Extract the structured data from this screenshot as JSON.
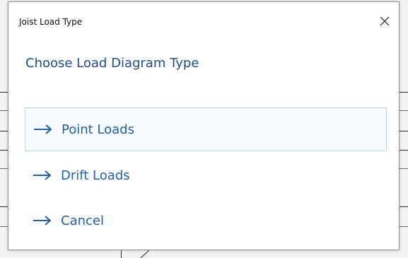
{
  "dialog": {
    "title": "Joist Load Type",
    "heading": "Choose Load Diagram Type",
    "close_icon": "close-icon",
    "options": [
      {
        "label": "Point Loads",
        "icon": "arrow-right-icon",
        "selected": true
      },
      {
        "label": "Drift Loads",
        "icon": "arrow-right-icon",
        "selected": false
      },
      {
        "label": "Cancel",
        "icon": "arrow-right-icon",
        "selected": false
      }
    ]
  },
  "colors": {
    "heading": "#1f4e8c",
    "option_text": "#1f60b0",
    "selected_bg": "#f7fbff",
    "selected_border": "#bcd7ee"
  }
}
